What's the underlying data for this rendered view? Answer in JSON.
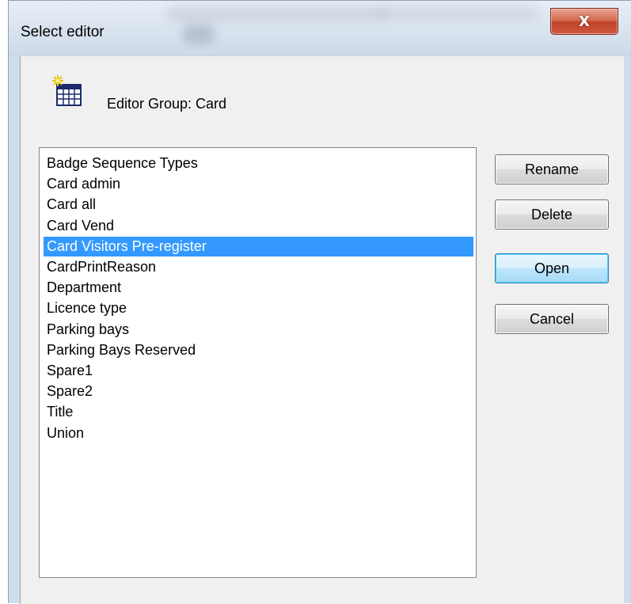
{
  "window": {
    "title": "Select editor",
    "close_symbol": "X"
  },
  "header": {
    "icon": "new-editor-icon",
    "group_label": "Editor Group: Card"
  },
  "list": {
    "items": [
      "Badge Sequence Types",
      "Card admin",
      "Card all",
      "Card Vend",
      "Card Visitors Pre-register",
      "CardPrintReason",
      "Department",
      "Licence type",
      "Parking bays",
      "Parking Bays Reserved",
      "Spare1",
      "Spare2",
      "Title",
      "Union"
    ],
    "selected_index": 4,
    "selected_color": "#3399ff"
  },
  "buttons": {
    "rename": "Rename",
    "delete": "Delete",
    "open": "Open",
    "cancel": "Cancel"
  }
}
